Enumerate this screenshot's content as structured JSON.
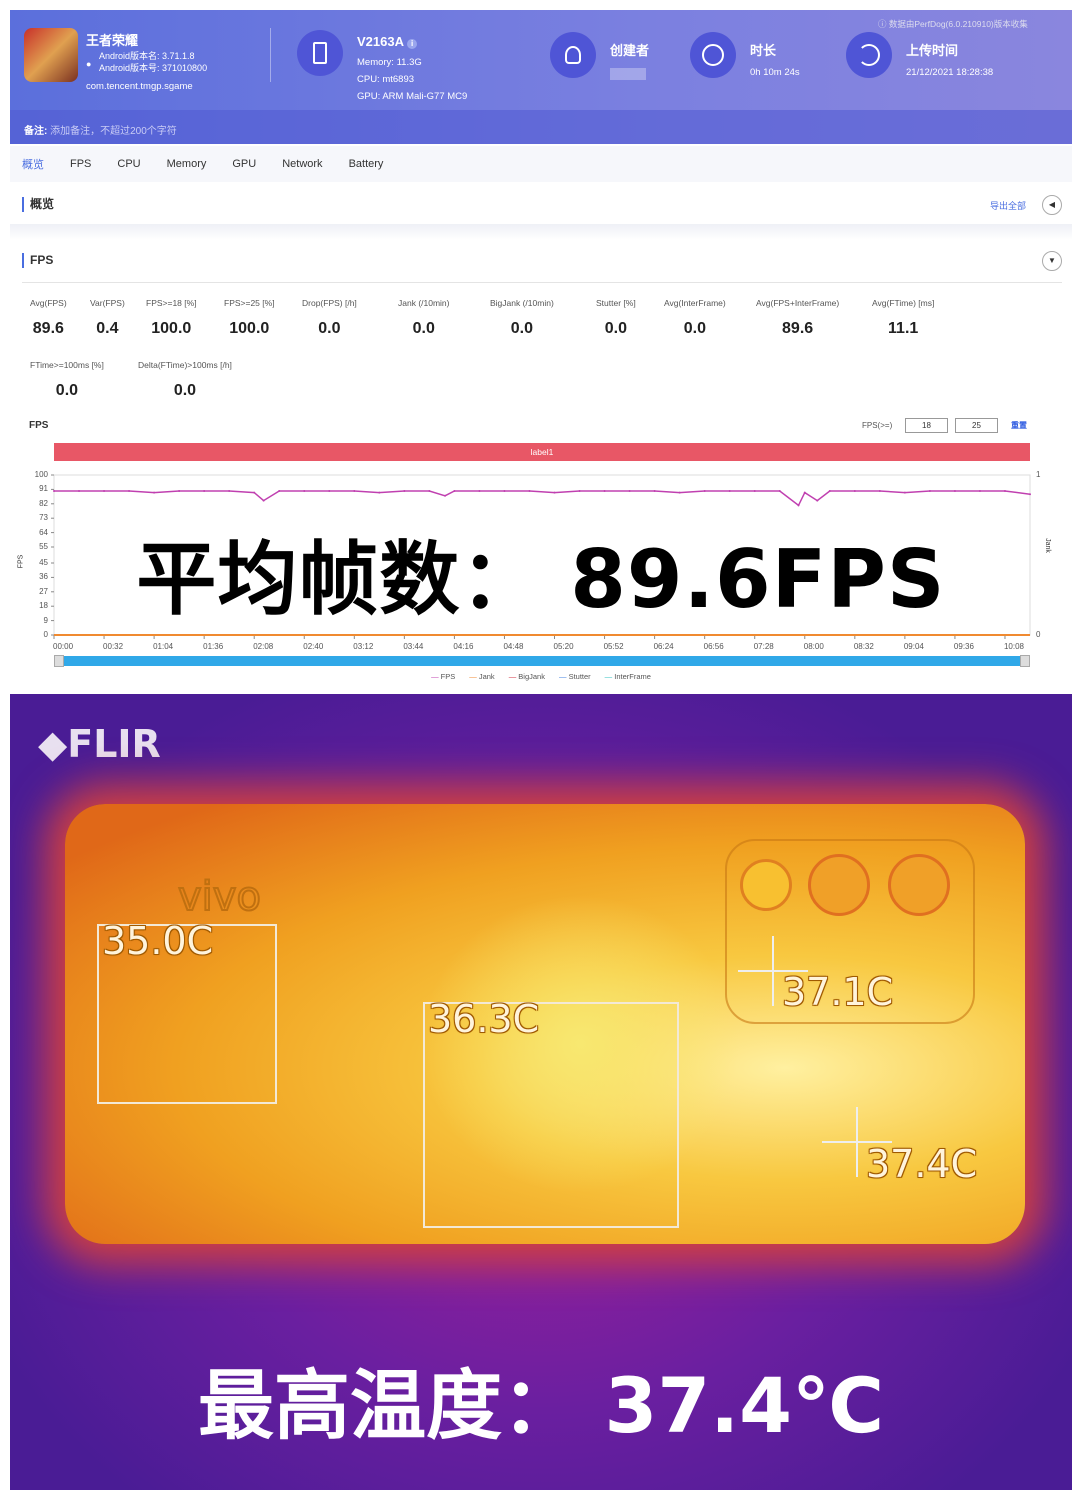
{
  "header": {
    "app_name": "王者荣耀",
    "version_name": "Android版本名: 3.71.1.8",
    "version_code": "Android版本号: 371010800",
    "package": "com.tencent.tmgp.sgame",
    "device": "V2163A",
    "memory": "Memory: 11.3G",
    "cpu": "CPU: mt6893",
    "gpu": "GPU: ARM Mali-G77 MC9",
    "creator_label": "创建者",
    "duration_label": "时长",
    "duration": "0h 10m 24s",
    "upload_label": "上传时间",
    "upload_time": "21/12/2021 18:28:38",
    "source_note": "数据由PerfDog(6.0.210910)版本收集",
    "remark_label": "备注:",
    "remark_placeholder": "添加备注，不超过200个字符"
  },
  "nav": {
    "tabs": [
      "概览",
      "FPS",
      "CPU",
      "Memory",
      "GPU",
      "Network",
      "Battery"
    ],
    "active": "概览"
  },
  "overview": {
    "title": "概览",
    "export": "导出全部"
  },
  "fps_section": {
    "title": "FPS",
    "stats": [
      {
        "label": "Avg(FPS)",
        "value": "89.6"
      },
      {
        "label": "Var(FPS)",
        "value": "0.4"
      },
      {
        "label": "FPS>=18 [%]",
        "value": "100.0"
      },
      {
        "label": "FPS>=25 [%]",
        "value": "100.0"
      },
      {
        "label": "Drop(FPS) [/h]",
        "value": "0.0"
      },
      {
        "label": "Jank (/10min)",
        "value": "0.0"
      },
      {
        "label": "BigJank (/10min)",
        "value": "0.0"
      },
      {
        "label": "Stutter [%]",
        "value": "0.0"
      },
      {
        "label": "Avg(InterFrame)",
        "value": "0.0"
      },
      {
        "label": "Avg(FPS+InterFrame)",
        "value": "89.6"
      },
      {
        "label": "Avg(FTime) [ms]",
        "value": "11.1"
      }
    ],
    "stats2": [
      {
        "label": "FTime>=100ms [%]",
        "value": "0.0"
      },
      {
        "label": "Delta(FTime)>100ms [/h]",
        "value": "0.0"
      }
    ]
  },
  "chart_controls": {
    "title": "FPS",
    "threshold_label": "FPS(>=)",
    "threshold1": "18",
    "threshold2": "25",
    "reset": "重置",
    "label_bar": "label1"
  },
  "overlay_text": "平均帧数： 89.6FPS",
  "chart_data": {
    "type": "line",
    "ylabel": "FPS",
    "y2label": "Jank",
    "ylim": [
      0,
      100
    ],
    "y2lim": [
      0,
      1
    ],
    "yticks": [
      "100",
      "91",
      "82",
      "73",
      "64",
      "55",
      "45",
      "36",
      "27",
      "18",
      "9",
      "0"
    ],
    "y2ticks": [
      "1",
      "0"
    ],
    "xticks": [
      "00:00",
      "00:32",
      "01:04",
      "01:36",
      "02:08",
      "02:40",
      "03:12",
      "03:44",
      "04:16",
      "04:48",
      "05:20",
      "05:52",
      "06:24",
      "06:56",
      "07:28",
      "08:00",
      "08:32",
      "09:04",
      "09:36",
      "10:08"
    ],
    "xlim_seconds": [
      0,
      624
    ],
    "series": [
      {
        "name": "FPS",
        "color": "#c040b0",
        "x": [
          0,
          16,
          32,
          48,
          64,
          80,
          96,
          112,
          128,
          134,
          144,
          160,
          176,
          192,
          208,
          224,
          240,
          250,
          256,
          272,
          288,
          304,
          320,
          336,
          352,
          368,
          384,
          400,
          416,
          432,
          448,
          464,
          476,
          480,
          488,
          496,
          512,
          528,
          544,
          560,
          576,
          592,
          608,
          624
        ],
        "y": [
          90,
          90,
          90,
          90,
          89,
          90,
          90,
          90,
          89,
          84,
          90,
          90,
          90,
          90,
          89,
          90,
          90,
          87,
          90,
          90,
          90,
          90,
          89,
          90,
          90,
          90,
          90,
          89,
          90,
          90,
          90,
          90,
          81,
          89,
          84,
          90,
          90,
          90,
          89,
          90,
          90,
          90,
          90,
          88
        ]
      },
      {
        "name": "Jank",
        "color": "#f08a30",
        "x": [
          0,
          624
        ],
        "y": [
          0,
          0
        ]
      },
      {
        "name": "BigJank",
        "color": "#d03040",
        "x": [],
        "y": []
      },
      {
        "name": "Stutter",
        "color": "#4080e0",
        "x": [],
        "y": []
      },
      {
        "name": "InterFrame",
        "color": "#30c0c0",
        "x": [],
        "y": []
      }
    ],
    "legend": [
      "FPS",
      "Jank",
      "BigJank",
      "Stutter",
      "InterFrame"
    ],
    "legend_position": "bottom"
  },
  "thermal": {
    "logo": "FLIR",
    "brand": "vivo",
    "spots": [
      "35.0C",
      "36.3C",
      "37.1C",
      "37.4C"
    ],
    "caption": "最高温度： 37.4℃"
  }
}
